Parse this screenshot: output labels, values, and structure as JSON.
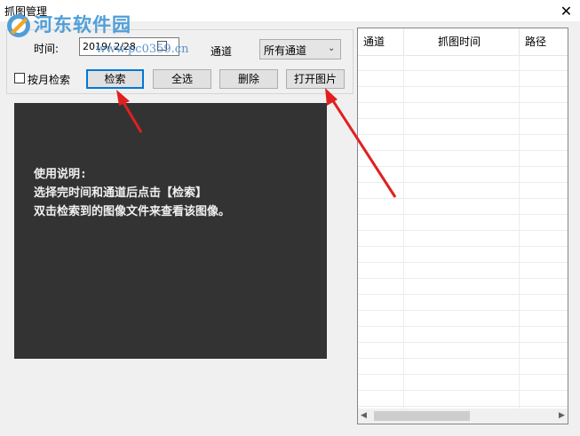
{
  "window": {
    "title": "抓图管理",
    "close_glyph": "✕"
  },
  "watermark": {
    "site_name": "河东软件园",
    "url": "www.pc0359.cn"
  },
  "filters": {
    "time_label": "时间:",
    "date_value": "2019/ 2/28",
    "channel_label": "通道",
    "channel_value": "所有通道",
    "monthly_search_label": "按月检索",
    "monthly_search_checked": false
  },
  "buttons": {
    "search": "检索",
    "select_all": "全选",
    "delete": "删除",
    "open_image": "打开图片"
  },
  "preview": {
    "instructions": "使用说明:\n选择完时间和通道后点击【检索】\n双击检索到的图像文件来查看该图像。"
  },
  "list": {
    "columns": [
      "通道",
      "抓图时间",
      "路径"
    ],
    "rows": []
  },
  "colors": {
    "accent": "#0078d7",
    "preview_bg": "#333333",
    "watermark": "#4f9ed8",
    "arrow": "#e02020"
  },
  "icons": {
    "close": "close-icon",
    "scroll_left": "chevron-left-icon",
    "scroll_right": "chevron-right-icon",
    "dropdown": "chevron-down-icon",
    "calendar": "calendar-icon"
  }
}
